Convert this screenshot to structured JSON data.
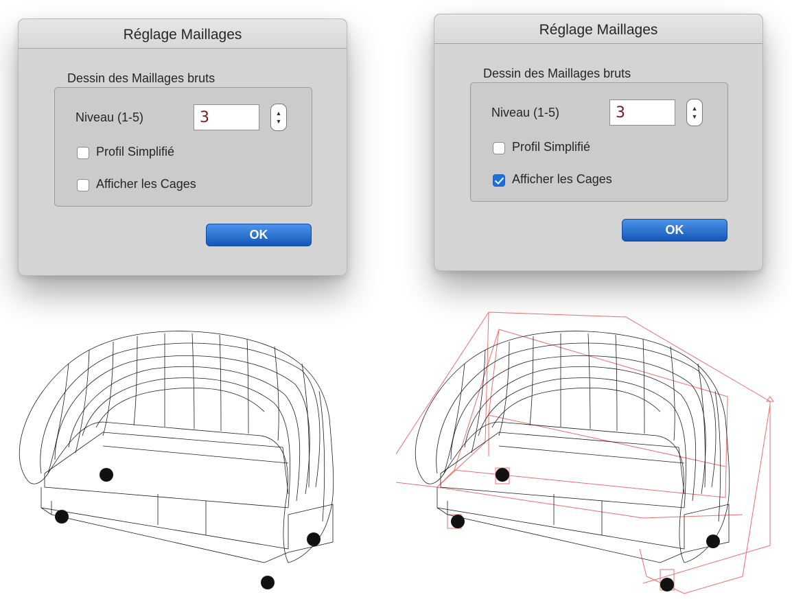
{
  "dialogs": [
    {
      "title": "Réglage Maillages",
      "section_label": "Dessin des Maillages bruts",
      "level_label": "Niveau (1-5)",
      "level_value": "3",
      "profile_label": "Profil Simplifié",
      "profile_checked": false,
      "cages_label": "Afficher les Cages",
      "cages_checked": false,
      "ok_label": "OK"
    },
    {
      "title": "Réglage Maillages",
      "section_label": "Dessin des Maillages bruts",
      "level_label": "Niveau (1-5)",
      "level_value": "3",
      "profile_label": "Profil Simplifié",
      "profile_checked": false,
      "cages_label": "Afficher les Cages",
      "cages_checked": true,
      "ok_label": "OK"
    }
  ],
  "colors": {
    "accent": "#1e6fd9",
    "mesh": "#1a1a1a",
    "cage": "#f26b6b",
    "dialog_bg": "#d4d4d4",
    "value_text": "#7a1a1a"
  },
  "icons": {
    "stepper": "stepper-arrows-icon",
    "checkmark": "checkmark-icon"
  }
}
